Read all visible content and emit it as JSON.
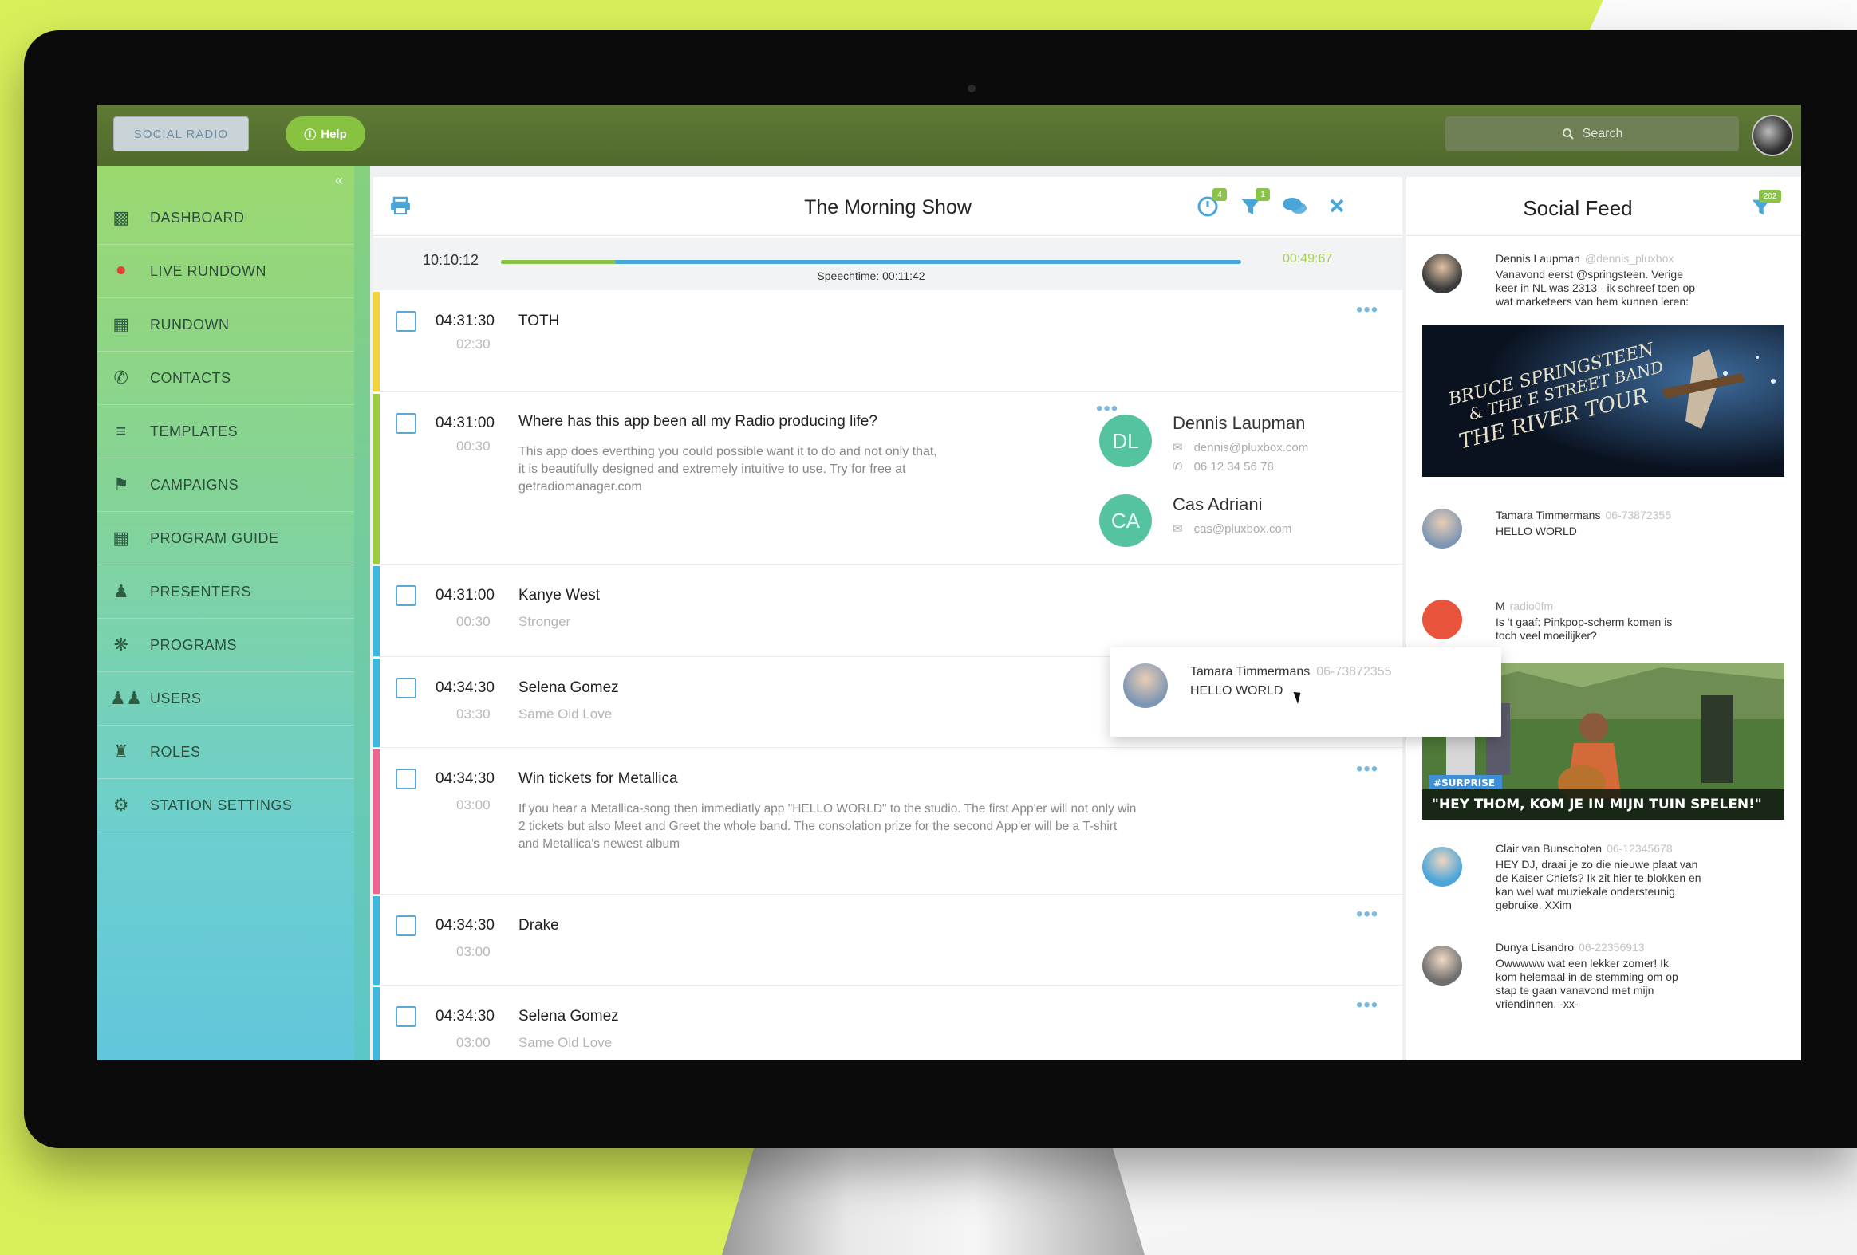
{
  "colors": {
    "lime_bg": "#d9ef5a",
    "topbar": "#566f30",
    "accent_green": "#8bc34a",
    "accent_blue": "#4aa6d9",
    "sidebar_top": "#9bd86f",
    "sidebar_bottom": "#62c6dc"
  },
  "topbar": {
    "logo_label": "SOCIAL RADIO",
    "help_label": "Help",
    "search_placeholder": "Search"
  },
  "sidebar": {
    "items": [
      {
        "label": "DASHBOARD",
        "icon": "dashboard-icon"
      },
      {
        "label": "LIVE RUNDOWN",
        "icon": "microphone-icon"
      },
      {
        "label": "RUNDOWN",
        "icon": "document-icon"
      },
      {
        "label": "CONTACTS",
        "icon": "phone-icon"
      },
      {
        "label": "TEMPLATES",
        "icon": "templates-icon"
      },
      {
        "label": "CAMPAIGNS",
        "icon": "megaphone-icon"
      },
      {
        "label": "PROGRAM GUIDE",
        "icon": "calendar-icon"
      },
      {
        "label": "PRESENTERS",
        "icon": "presenter-icon"
      },
      {
        "label": "PROGRAMS",
        "icon": "antenna-icon"
      },
      {
        "label": "USERS",
        "icon": "users-icon"
      },
      {
        "label": "ROLES",
        "icon": "roles-icon"
      },
      {
        "label": "STATION SETTINGS",
        "icon": "gear-icon"
      }
    ]
  },
  "show": {
    "title": "The Morning Show",
    "clock": "10:10:12",
    "progress": 0.155,
    "speechtime": "Speechtime: 00:11:42",
    "end_time": "00:49:67",
    "badges": {
      "timer": "4",
      "filter": "1"
    }
  },
  "rundown": [
    {
      "time": "04:31:30",
      "duration": "02:30",
      "title": "TOTH",
      "stripe": "#f3d23a"
    },
    {
      "time": "04:31:00",
      "duration": "00:30",
      "title": "Where has this app been all my Radio producing life?",
      "body": [
        "This app does everthing you could possible want it to do and not only that,",
        "it is beautifully designed and extremely intuitive to use. Try for free at",
        "getradiomanager.com"
      ],
      "stripe": "#9ccc3d"
    },
    {
      "time": "04:31:00",
      "duration": "00:30",
      "title": "Kanye West",
      "subtitle": "Stronger",
      "stripe": "#3cb8e0"
    },
    {
      "time": "04:34:30",
      "duration": "03:30",
      "title": "Selena Gomez",
      "subtitle": "Same Old Love",
      "stripe": "#3cb8e0"
    },
    {
      "time": "04:34:30",
      "duration": "03:00",
      "title": "Win tickets for Metallica",
      "body": [
        "If you hear a Metallica-song then immediatly app \"HELLO WORLD\" to the studio. The first App'er will not only win",
        "2 tickets but also Meet and Greet the whole band. The consolation prize for the second App'er will be a T-shirt",
        "and Metallica's newest album"
      ],
      "stripe": "#f06292"
    },
    {
      "time": "04:34:30",
      "duration": "03:00",
      "title": "Drake",
      "stripe": "#3cb8e0"
    },
    {
      "time": "04:34:30",
      "duration": "03:00",
      "title": "Selena Gomez",
      "subtitle": "Same Old Love",
      "stripe": "#3cb8e0"
    }
  ],
  "contacts": [
    {
      "initials": "DL",
      "name": "Dennis Laupman",
      "email": "dennis@pluxbox.com",
      "phone": "06 12 34 56 78"
    },
    {
      "initials": "CA",
      "name": "Cas Adriani",
      "email": "cas@pluxbox.com"
    }
  ],
  "popover": {
    "name": "Tamara Timmermans",
    "phone": "06-73872355",
    "message": "HELLO WORLD"
  },
  "feed": {
    "title": "Social Feed",
    "filter_badge": "202",
    "posts": [
      {
        "name": "Dennis Laupman",
        "meta": "@dennis_pluxbox",
        "text": [
          "Vanavond eerst @springsteen. Verige",
          "keer in NL was 2313 - ik schreef toen op",
          "wat marketeers van hem kunnen leren:"
        ]
      },
      {
        "name": "Tamara Timmermans",
        "meta": "06-73872355",
        "text": [
          "HELLO WORLD"
        ]
      },
      {
        "name": "M",
        "meta": "radio0fm",
        "text": [
          "Is 't gaaf: Pinkpop-scherm komen is",
          "toch veel moeilijker?"
        ]
      },
      {
        "name": "Clair van Bunschoten",
        "meta": "06-12345678",
        "text": [
          "HEY DJ, draai je zo die nieuwe plaat van",
          "de Kaiser Chiefs? Ik zit hier te blokken en",
          "kan wel wat muziekale ondersteunig",
          "gebruike. XXim"
        ]
      },
      {
        "name": "Dunya Lisandro",
        "meta": "06-22356913",
        "text": [
          "Owwwww wat een lekker zomer! Ik",
          "kom helemaal in de stemming om op",
          "stap te gaan vanavond met mijn",
          "vriendinnen. -xx-"
        ]
      }
    ],
    "images": [
      {
        "caption_lines": [
          "BRUCE SPRINGSTEEN",
          "& THE E STREET BAND",
          "THE RIVER TOUR"
        ]
      },
      {
        "tag": "#SURPRISE",
        "caption": "\"HEY THOM, KOM JE IN MIJN TUIN SPELEN!\""
      }
    ]
  }
}
